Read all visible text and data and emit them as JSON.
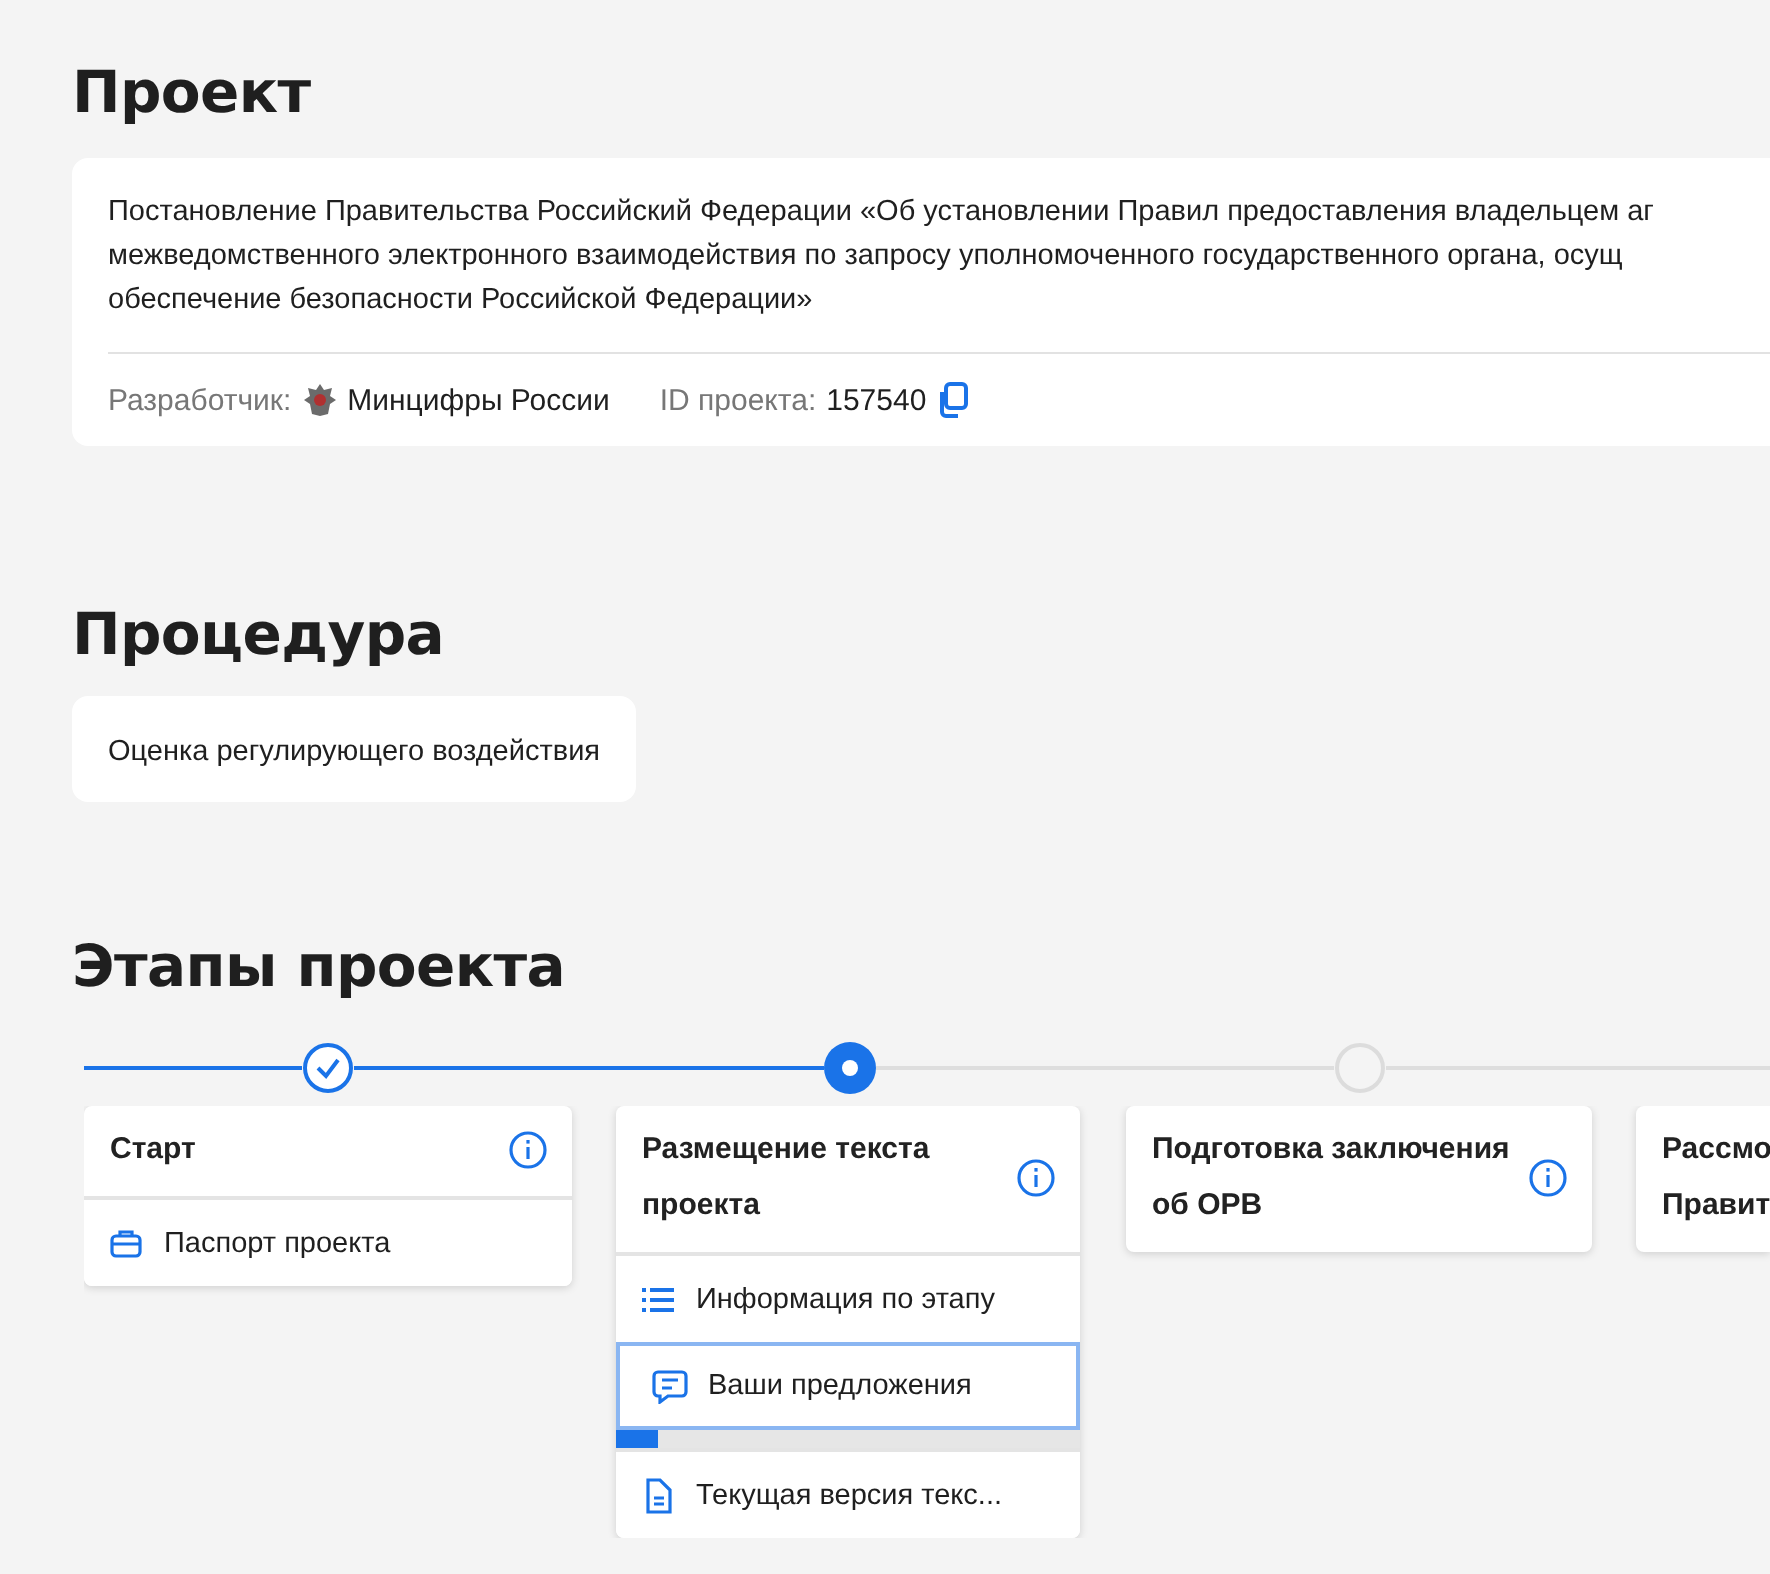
{
  "project": {
    "heading": "Проект",
    "description": "Постановление Правительства Российский Федерации «Об установлении Правил предоставления владельцем аг\nмежведомственного электронного взаимодействия по запросу уполномоченного государственного органа, осущ\nобеспечение безопасности Российской Федерации»",
    "developer_label": "Разработчик:",
    "developer": "Минцифры России",
    "id_label": "ID проекта:",
    "id": "157540"
  },
  "procedure": {
    "heading": "Процедура",
    "name": "Оценка регулирующего воздействия"
  },
  "stages": {
    "heading": "Этапы проекта",
    "items": [
      {
        "title": "Старт",
        "done": true,
        "has_info": true,
        "links": [
          {
            "kind": "briefcase",
            "label": "Паспорт проекта",
            "selected": false
          }
        ]
      },
      {
        "title": "Размещение текста\nпроекта",
        "done": false,
        "current": true,
        "has_info": true,
        "links": [
          {
            "kind": "list",
            "label": "Информация по этапу",
            "selected": false
          },
          {
            "kind": "comment",
            "label": "Ваши предложения",
            "selected": true,
            "level": 0.09
          },
          {
            "kind": "document",
            "label": "Текущая версия текс...",
            "selected": false
          }
        ]
      },
      {
        "title": "Подготовка заключения\nоб ОРВ",
        "done": false,
        "current": false,
        "has_info": true
      },
      {
        "title": "Рассмо\nПравит",
        "has_info": false
      }
    ]
  }
}
